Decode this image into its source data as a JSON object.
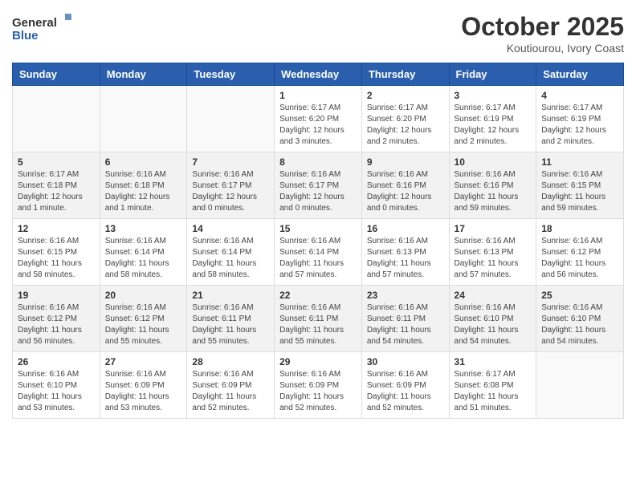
{
  "logo": {
    "general": "General",
    "blue": "Blue"
  },
  "header": {
    "month": "October 2025",
    "location": "Koutiourou, Ivory Coast"
  },
  "weekdays": [
    "Sunday",
    "Monday",
    "Tuesday",
    "Wednesday",
    "Thursday",
    "Friday",
    "Saturday"
  ],
  "weeks": [
    [
      {
        "day": "",
        "info": ""
      },
      {
        "day": "",
        "info": ""
      },
      {
        "day": "",
        "info": ""
      },
      {
        "day": "1",
        "info": "Sunrise: 6:17 AM\nSunset: 6:20 PM\nDaylight: 12 hours and 3 minutes."
      },
      {
        "day": "2",
        "info": "Sunrise: 6:17 AM\nSunset: 6:20 PM\nDaylight: 12 hours and 2 minutes."
      },
      {
        "day": "3",
        "info": "Sunrise: 6:17 AM\nSunset: 6:19 PM\nDaylight: 12 hours and 2 minutes."
      },
      {
        "day": "4",
        "info": "Sunrise: 6:17 AM\nSunset: 6:19 PM\nDaylight: 12 hours and 2 minutes."
      }
    ],
    [
      {
        "day": "5",
        "info": "Sunrise: 6:17 AM\nSunset: 6:18 PM\nDaylight: 12 hours and 1 minute."
      },
      {
        "day": "6",
        "info": "Sunrise: 6:16 AM\nSunset: 6:18 PM\nDaylight: 12 hours and 1 minute."
      },
      {
        "day": "7",
        "info": "Sunrise: 6:16 AM\nSunset: 6:17 PM\nDaylight: 12 hours and 0 minutes."
      },
      {
        "day": "8",
        "info": "Sunrise: 6:16 AM\nSunset: 6:17 PM\nDaylight: 12 hours and 0 minutes."
      },
      {
        "day": "9",
        "info": "Sunrise: 6:16 AM\nSunset: 6:16 PM\nDaylight: 12 hours and 0 minutes."
      },
      {
        "day": "10",
        "info": "Sunrise: 6:16 AM\nSunset: 6:16 PM\nDaylight: 11 hours and 59 minutes."
      },
      {
        "day": "11",
        "info": "Sunrise: 6:16 AM\nSunset: 6:15 PM\nDaylight: 11 hours and 59 minutes."
      }
    ],
    [
      {
        "day": "12",
        "info": "Sunrise: 6:16 AM\nSunset: 6:15 PM\nDaylight: 11 hours and 58 minutes."
      },
      {
        "day": "13",
        "info": "Sunrise: 6:16 AM\nSunset: 6:14 PM\nDaylight: 11 hours and 58 minutes."
      },
      {
        "day": "14",
        "info": "Sunrise: 6:16 AM\nSunset: 6:14 PM\nDaylight: 11 hours and 58 minutes."
      },
      {
        "day": "15",
        "info": "Sunrise: 6:16 AM\nSunset: 6:14 PM\nDaylight: 11 hours and 57 minutes."
      },
      {
        "day": "16",
        "info": "Sunrise: 6:16 AM\nSunset: 6:13 PM\nDaylight: 11 hours and 57 minutes."
      },
      {
        "day": "17",
        "info": "Sunrise: 6:16 AM\nSunset: 6:13 PM\nDaylight: 11 hours and 57 minutes."
      },
      {
        "day": "18",
        "info": "Sunrise: 6:16 AM\nSunset: 6:12 PM\nDaylight: 11 hours and 56 minutes."
      }
    ],
    [
      {
        "day": "19",
        "info": "Sunrise: 6:16 AM\nSunset: 6:12 PM\nDaylight: 11 hours and 56 minutes."
      },
      {
        "day": "20",
        "info": "Sunrise: 6:16 AM\nSunset: 6:12 PM\nDaylight: 11 hours and 55 minutes."
      },
      {
        "day": "21",
        "info": "Sunrise: 6:16 AM\nSunset: 6:11 PM\nDaylight: 11 hours and 55 minutes."
      },
      {
        "day": "22",
        "info": "Sunrise: 6:16 AM\nSunset: 6:11 PM\nDaylight: 11 hours and 55 minutes."
      },
      {
        "day": "23",
        "info": "Sunrise: 6:16 AM\nSunset: 6:11 PM\nDaylight: 11 hours and 54 minutes."
      },
      {
        "day": "24",
        "info": "Sunrise: 6:16 AM\nSunset: 6:10 PM\nDaylight: 11 hours and 54 minutes."
      },
      {
        "day": "25",
        "info": "Sunrise: 6:16 AM\nSunset: 6:10 PM\nDaylight: 11 hours and 54 minutes."
      }
    ],
    [
      {
        "day": "26",
        "info": "Sunrise: 6:16 AM\nSunset: 6:10 PM\nDaylight: 11 hours and 53 minutes."
      },
      {
        "day": "27",
        "info": "Sunrise: 6:16 AM\nSunset: 6:09 PM\nDaylight: 11 hours and 53 minutes."
      },
      {
        "day": "28",
        "info": "Sunrise: 6:16 AM\nSunset: 6:09 PM\nDaylight: 11 hours and 52 minutes."
      },
      {
        "day": "29",
        "info": "Sunrise: 6:16 AM\nSunset: 6:09 PM\nDaylight: 11 hours and 52 minutes."
      },
      {
        "day": "30",
        "info": "Sunrise: 6:16 AM\nSunset: 6:09 PM\nDaylight: 11 hours and 52 minutes."
      },
      {
        "day": "31",
        "info": "Sunrise: 6:17 AM\nSunset: 6:08 PM\nDaylight: 11 hours and 51 minutes."
      },
      {
        "day": "",
        "info": ""
      }
    ]
  ]
}
